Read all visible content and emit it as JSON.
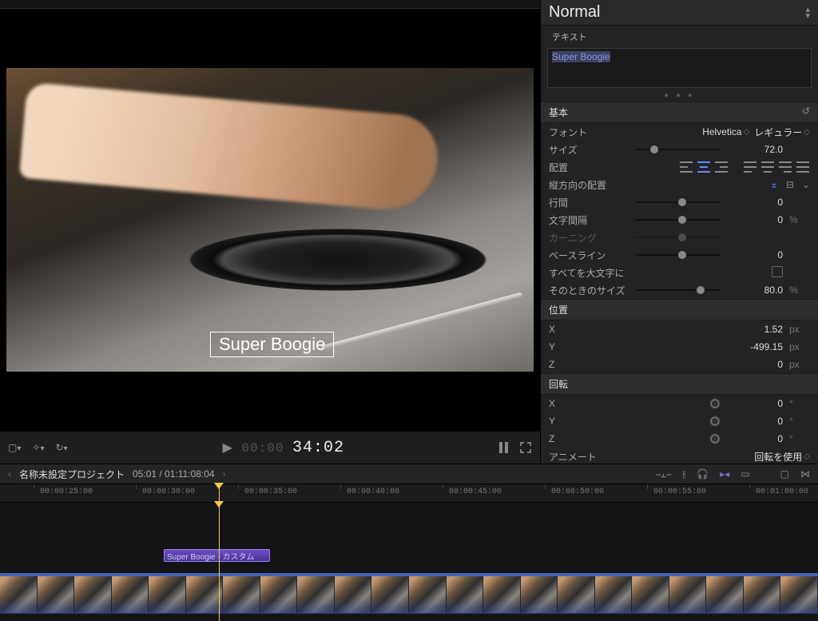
{
  "inspector": {
    "preset": "Normal",
    "text_label": "テキスト",
    "text_value": "Super Boogie",
    "sections": {
      "basic": "基本",
      "position": "位置",
      "rotation": "回転"
    },
    "font": {
      "label": "フォント",
      "family": "Helvetica",
      "style": "レギュラー"
    },
    "size": {
      "label": "サイズ",
      "value": "72.0"
    },
    "alignment": {
      "label": "配置"
    },
    "valign": {
      "label": "縦方向の配置"
    },
    "linespacing": {
      "label": "行間",
      "value": "0"
    },
    "tracking": {
      "label": "文字間隔",
      "value": "0",
      "unit": "%"
    },
    "kerning": {
      "label": "カーニング"
    },
    "baseline": {
      "label": "ベースライン",
      "value": "0"
    },
    "allcaps": {
      "label": "すべてを大文字に"
    },
    "capsize": {
      "label": "そのときのサイズ",
      "value": "80.0",
      "unit": "%"
    },
    "pos": {
      "x": {
        "label": "X",
        "value": "1.52",
        "unit": "px"
      },
      "y": {
        "label": "Y",
        "value": "-499.15",
        "unit": "px"
      },
      "z": {
        "label": "Z",
        "value": "0",
        "unit": "px"
      }
    },
    "rot": {
      "x": {
        "label": "X",
        "value": "0",
        "unit": "°"
      },
      "y": {
        "label": "Y",
        "value": "0",
        "unit": "°"
      },
      "z": {
        "label": "Z",
        "value": "0",
        "unit": "°"
      }
    },
    "animate": {
      "label": "アニメート",
      "value": "回転を使用"
    }
  },
  "viewer": {
    "overlay_text": "Super Boogie",
    "tc_prefix": "00:00",
    "tc_main": "34:02"
  },
  "timeline": {
    "project": "名称未設定プロジェクト",
    "pos": "05:01 / 01:11:08:04",
    "clip_title": "Super Boogie - カスタム",
    "ruler": [
      "00:00:25:00",
      "00:00:30:00",
      "00:00:35:00",
      "00:00:40:00",
      "00:00:45:00",
      "00:00:50:00",
      "00:00:55:00",
      "00:01:00:00"
    ]
  }
}
